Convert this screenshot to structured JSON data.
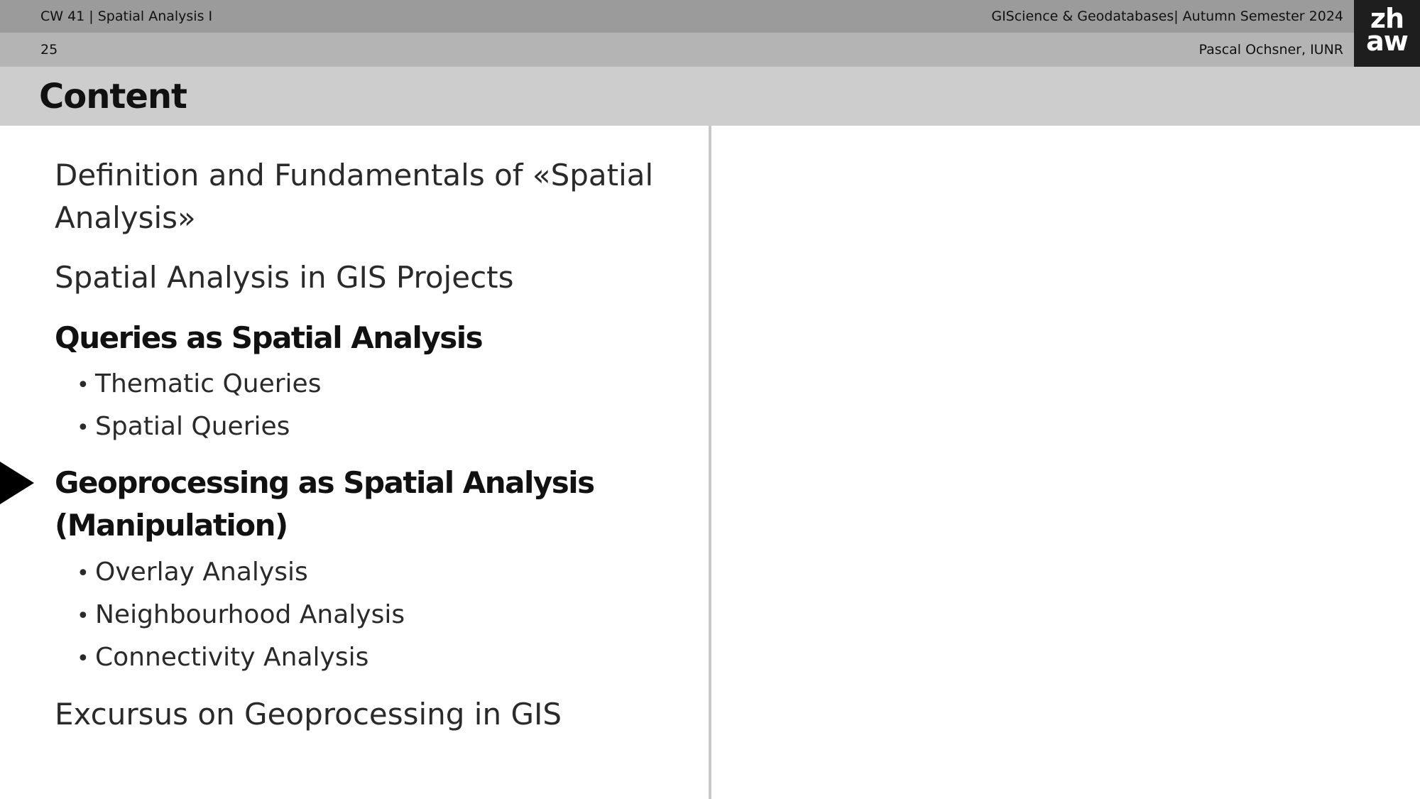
{
  "header": {
    "course_lecture": "CW 41 | Spatial Analysis I",
    "module_semester": "GIScience & Geodatabases| Autumn Semester 2024",
    "slide_number": "25",
    "author": "Pascal Ochsner, IUNR"
  },
  "logo": {
    "line1": "zh",
    "line2": "aw"
  },
  "title": "Content",
  "agenda": {
    "item1": "Definition and Fundamentals of «Spatial Analysis»",
    "item2": "Spatial Analysis in GIS Projects",
    "item3": "Queries as Spatial Analysis",
    "item3_sub": [
      "Thematic Queries",
      "Spatial Queries"
    ],
    "item4": "Geoprocessing as Spatial Analysis (Manipulation)",
    "item4_sub": [
      "Overlay Analysis",
      "Neighbourhood Analysis",
      "Connectivity Analysis"
    ],
    "item5": "Excursus on Geoprocessing in GIS",
    "bullet_char": "•"
  },
  "colors": {
    "header_bar_dark": "#9b9b9b",
    "header_bar_mid": "#b4b4b4",
    "title_bar": "#cdcdcd",
    "logo_bg": "#1e1e1e",
    "current_marker": "#000000"
  }
}
